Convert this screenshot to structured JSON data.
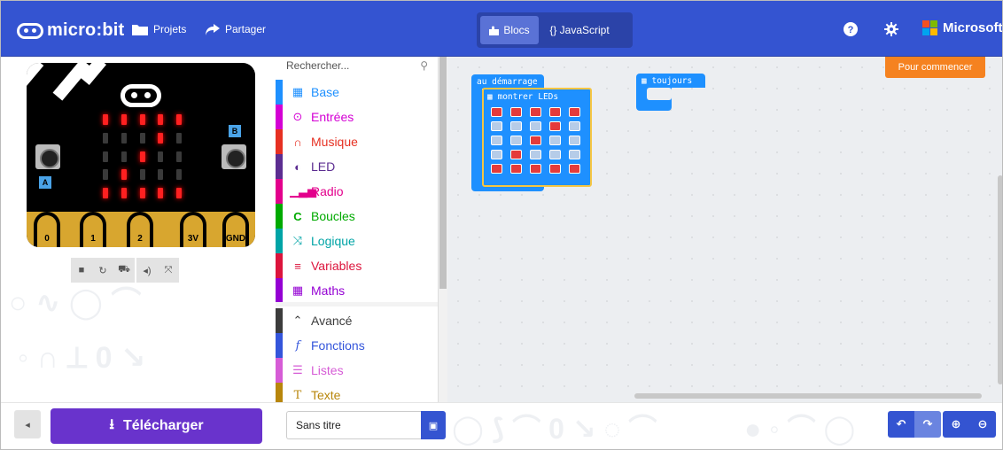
{
  "header": {
    "logo_text": "micro:bit",
    "projects_label": "Projets",
    "share_label": "Partager",
    "tabs": [
      {
        "label": "Blocs",
        "active": true
      },
      {
        "label": "{} JavaScript",
        "active": false
      }
    ],
    "microsoft_label": "Microsoft",
    "brand_color": "#3454d1"
  },
  "simulator": {
    "pin_labels": [
      "0",
      "1",
      "2",
      "3V",
      "GND"
    ],
    "button_a": "A",
    "button_b": "B",
    "leds": [
      [
        1,
        1,
        1,
        1,
        1
      ],
      [
        0,
        0,
        0,
        1,
        0
      ],
      [
        0,
        0,
        1,
        0,
        0
      ],
      [
        0,
        1,
        0,
        0,
        0
      ],
      [
        1,
        1,
        1,
        1,
        1
      ]
    ],
    "controls": [
      "stop-icon",
      "restart-icon",
      "debug-icon",
      "mute-icon",
      "fullscreen-icon"
    ]
  },
  "toolbox": {
    "search_placeholder": "Rechercher...",
    "categories": [
      {
        "label": "Base",
        "color": "#1e90ff",
        "icon": "grid-icon"
      },
      {
        "label": "Entrées",
        "color": "#d400d4",
        "icon": "target-icon"
      },
      {
        "label": "Musique",
        "color": "#e63022",
        "icon": "headphones-icon"
      },
      {
        "label": "LED",
        "color": "#5c2d91",
        "icon": "toggle-icon"
      },
      {
        "label": "Radio",
        "color": "#e3008c",
        "icon": "signal-icon"
      },
      {
        "label": "Boucles",
        "color": "#00aa00",
        "icon": "loop-icon"
      },
      {
        "label": "Logique",
        "color": "#00a4a6",
        "icon": "shuffle-icon"
      },
      {
        "label": "Variables",
        "color": "#dc143c",
        "icon": "lines-icon"
      },
      {
        "label": "Maths",
        "color": "#9400d3",
        "icon": "calculator-icon"
      }
    ],
    "advanced": [
      {
        "label": "Avancé",
        "color": "#3c3c3c",
        "icon": "chevron-up-icon"
      },
      {
        "label": "Fonctions",
        "color": "#3455db",
        "icon": "function-icon"
      },
      {
        "label": "Listes",
        "color": "#d65cd6",
        "icon": "list-icon"
      },
      {
        "label": "Texte",
        "color": "#b8860b",
        "icon": "text-icon"
      }
    ]
  },
  "workspace": {
    "start_button": "Pour commencer",
    "on_start_label": "au démarrage",
    "show_leds_label": "montrer LEDs",
    "forever_label": "toujours",
    "led_pattern": [
      [
        1,
        1,
        1,
        1,
        1
      ],
      [
        0,
        0,
        0,
        1,
        0
      ],
      [
        0,
        0,
        1,
        0,
        0
      ],
      [
        0,
        1,
        0,
        0,
        0
      ],
      [
        1,
        1,
        1,
        1,
        1
      ]
    ]
  },
  "bottom": {
    "download_label": "Télécharger",
    "project_name": "Sans titre"
  }
}
